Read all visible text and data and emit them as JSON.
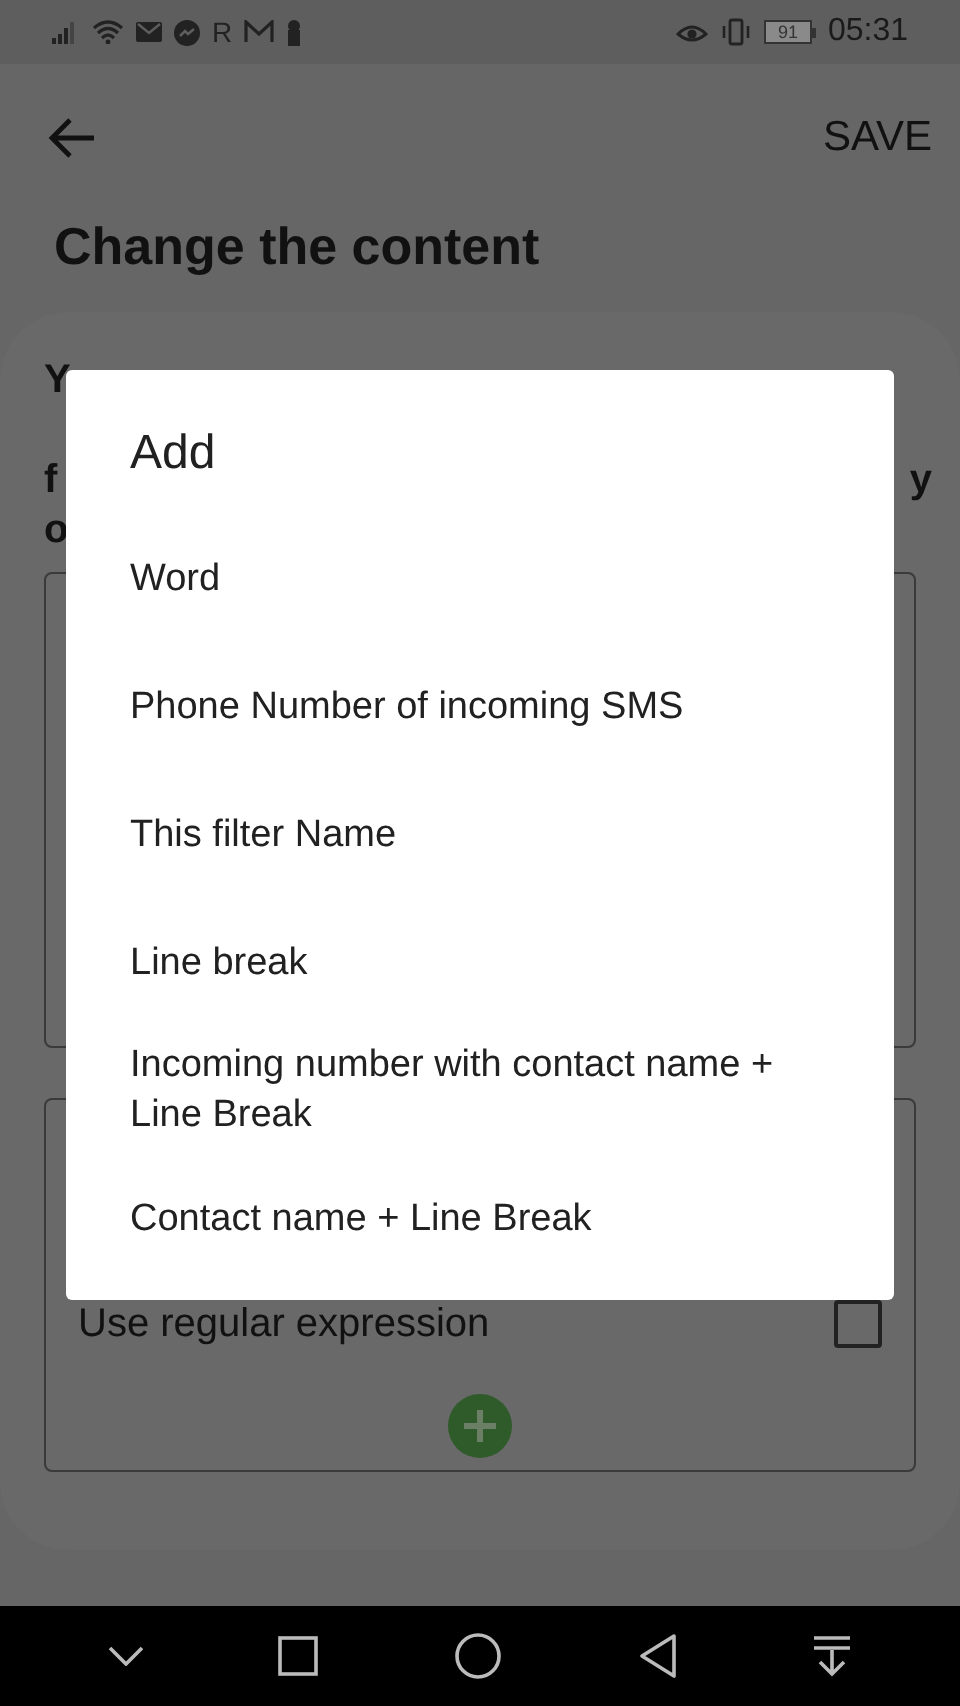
{
  "status_bar": {
    "letter_icon": "R",
    "battery": "91",
    "time": "05:31"
  },
  "toolbar": {
    "action": "SAVE"
  },
  "title": "Change the content",
  "description": {
    "first_line": "Y",
    "later_lines": [
      {
        "left": "f",
        "right": "y"
      },
      {
        "left": "o"
      }
    ]
  },
  "regex_option": {
    "label": "Use regular expression",
    "checked": false
  },
  "dialog": {
    "title": "Add",
    "items": [
      "Word",
      "Phone Number of incoming SMS",
      "This filter Name",
      "Line break",
      "Incoming number with contact name + Line Break",
      "Contact name + Line Break"
    ]
  }
}
